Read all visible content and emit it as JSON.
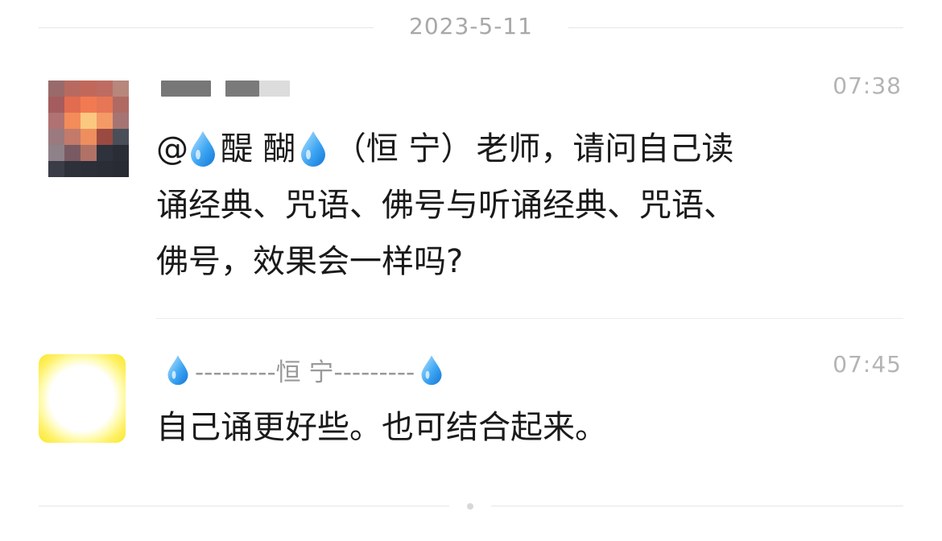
{
  "date_separator": "2023-5-11",
  "messages": [
    {
      "time": "07:38",
      "mention_prefix": "@",
      "mention_name": "醍 醐",
      "mention_suffix": "（恒 宁）",
      "lines": [
        "老师，请问自己读",
        "诵经典、咒语、佛号与听诵经典、咒语、",
        "佛号，效果会一样吗?"
      ]
    },
    {
      "sender_name": "---------恒 宁---------",
      "time": "07:45",
      "text": "自己诵更好些。也可结合起来。"
    }
  ],
  "icons": {
    "water_drop": "droplet-icon",
    "avatar_1": "pixelated-avatar",
    "avatar_2": "yellow-glow-avatar"
  },
  "colors": {
    "drop_light": "#9ed8ff",
    "drop_dark": "#1b8be6",
    "avatar_2_edge": "#f6e826"
  }
}
